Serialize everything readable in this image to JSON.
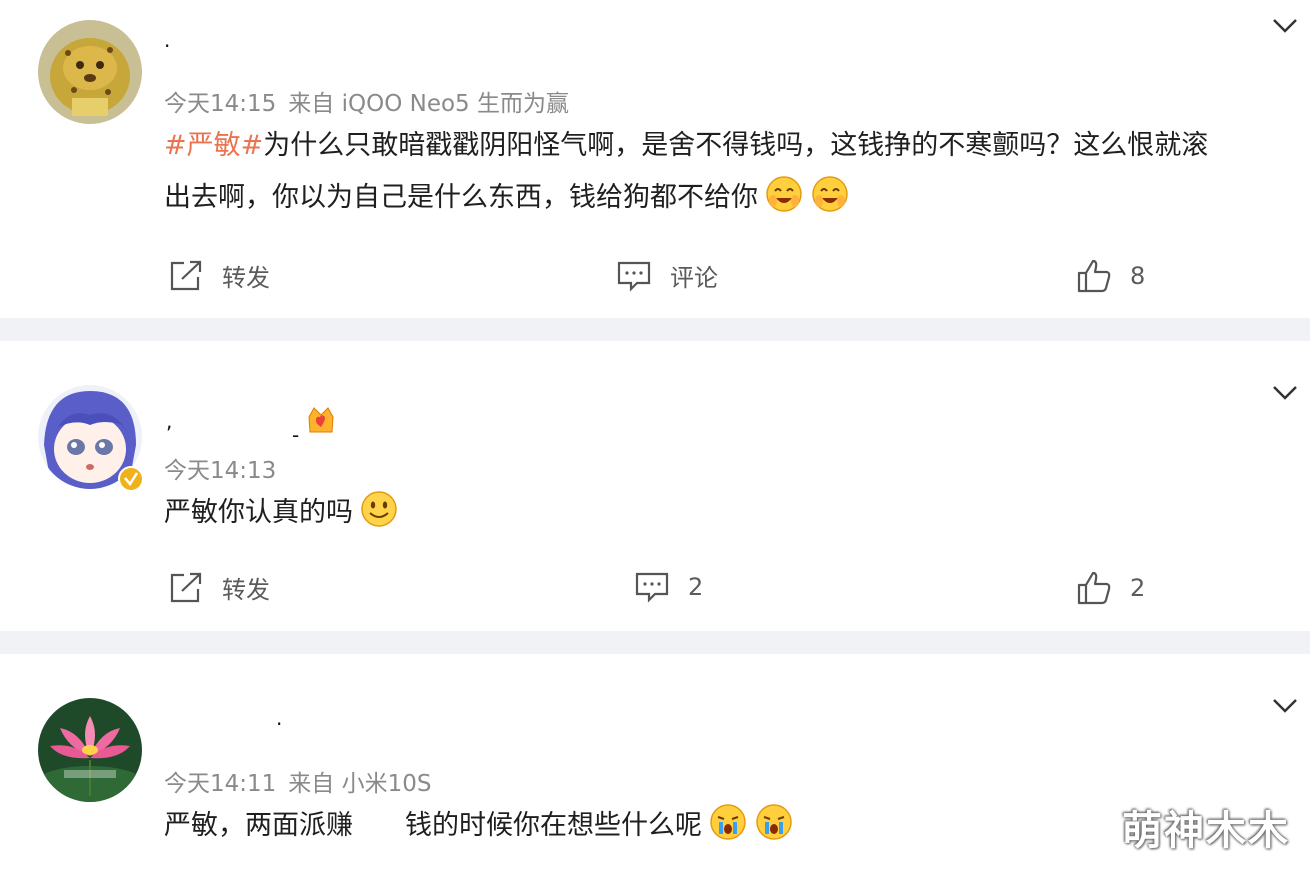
{
  "posts": [
    {
      "time": "今天14:15",
      "source": "来自 iQOO Neo5 生而为赢",
      "hashtag": "#严敏#",
      "line1": "为什么只敢暗戳戳阴阳怪气啊，是舍不得钱吗，这钱挣的不寒颤吗？这么恨就滚",
      "line2": "出去啊，你以为自己是什么东西，钱给狗都不给你",
      "emojis": [
        "smiling-face-icon",
        "smiling-face-icon"
      ],
      "repost_label": "转发",
      "comment_label": "评论",
      "like_count": "8"
    },
    {
      "time": "今天14:13",
      "text": "严敏你认真的吗",
      "emojis": [
        "smile-icon"
      ],
      "repost_label": "转发",
      "comment_count": "2",
      "like_count": "2"
    },
    {
      "time": "今天14:11",
      "source": "来自 小米10S",
      "text_a": "严敏，两面派赚",
      "text_b": "钱的时候你在想些什么呢",
      "emojis": [
        "crying-face-icon",
        "crying-face-icon"
      ]
    }
  ],
  "watermark": "萌神木木",
  "colors": {
    "hashtag": "#eb7350",
    "meta": "#8a8a8a",
    "separator": "#f1f2f5"
  }
}
